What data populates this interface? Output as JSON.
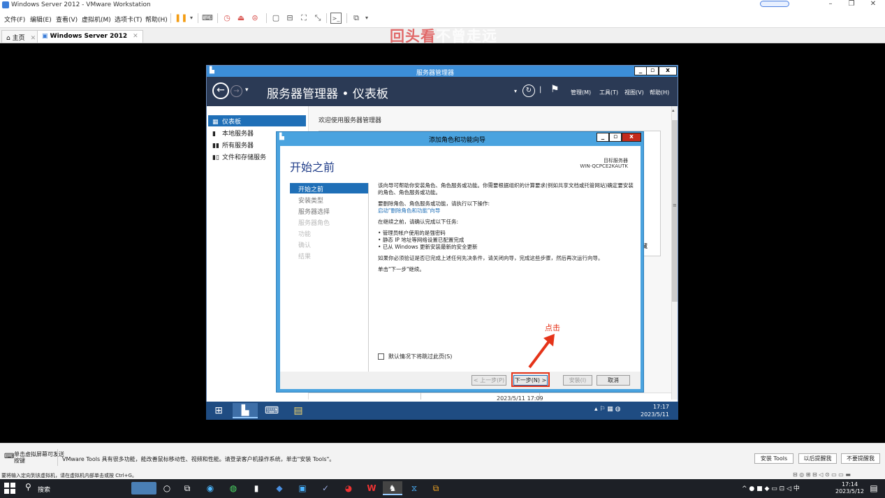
{
  "host": {
    "title": "Windows Server 2012 - VMware Workstation",
    "menus": [
      "文件(F)",
      "编辑(E)",
      "查看(V)",
      "虚拟机(M)",
      "选项卡(T)",
      "帮助(H)"
    ],
    "tabs": [
      {
        "label": "主页"
      },
      {
        "label": "Windows Server 2012"
      }
    ],
    "watermark_red": "回头看",
    "watermark_white": "不曾走远"
  },
  "server_manager": {
    "window_title": "服务器管理器",
    "breadcrumb": "服务器管理器 • 仪表板",
    "menus": [
      "管理(M)",
      "工具(T)",
      "视图(V)",
      "帮助(H)"
    ],
    "sidebar": [
      {
        "label": "仪表板",
        "icon": "grid-icon"
      },
      {
        "label": "本地服务器",
        "icon": "server-icon"
      },
      {
        "label": "所有服务器",
        "icon": "servers-icon"
      },
      {
        "label": "文件和存储服务",
        "icon": "storage-icon"
      }
    ],
    "welcome": "欢迎使用服务器管理器",
    "right_char": "藏",
    "date_footer": "2023/5/11 17:09"
  },
  "wizard": {
    "window_title": "添加角色和功能向导",
    "heading": "开始之前",
    "target_label": "目标服务器",
    "target_server": "WIN-QCPCE2KAUTK",
    "steps": [
      {
        "label": "开始之前",
        "state": "active"
      },
      {
        "label": "安装类型",
        "state": "normal"
      },
      {
        "label": "服务器选择",
        "state": "normal"
      },
      {
        "label": "服务器角色",
        "state": "dim"
      },
      {
        "label": "功能",
        "state": "dim"
      },
      {
        "label": "确认",
        "state": "dim"
      },
      {
        "label": "结果",
        "state": "dim"
      }
    ],
    "para1": "该向导可帮助你安装角色、角色服务或功能。你需要根据组织的计算要求(例如共享文档或托管网站)确定要安装的角色、角色服务或功能。",
    "para2_label": "要删除角色、角色服务或功能，请执行以下操作:",
    "para2_link": "启动\"删除角色和功能\"向导",
    "para3": "在继续之前，请确认完成以下任务:",
    "bullets": [
      "管理员帐户使用的是强密码",
      "静态 IP 地址等网络设置已配置完成",
      "已从 Windows 更新安装最新的安全更新"
    ],
    "para4": "如果你必须验证是否已完成上述任何先决条件，请关闭向导，完成这些步骤，然后再次运行向导。",
    "para5": "单击\"下一步\"继续。",
    "skip_label": "默认情况下将跳过此页(S)",
    "buttons": {
      "prev": "< 上一步(P)",
      "next": "下一步(N) >",
      "install": "安装(I)",
      "cancel": "取消"
    }
  },
  "annotation": {
    "text": "点击",
    "color": "#e53319"
  },
  "guest_taskbar": {
    "time": "17:17",
    "date": "2023/5/11"
  },
  "tools_bar": {
    "hint": "单击虚拟屏幕可发送按键",
    "message": "VMware Tools 具有很多功能，能改善鼠标移动性、视频和性能。请登录客户机操作系统，单击\"安装 Tools\"。",
    "buttons": [
      "安装 Tools",
      "以后提醒我",
      "不要提醒我"
    ]
  },
  "status_bar": {
    "text": "要将输入定向到该虚拟机，请在虚拟机内部单击或按 Ctrl+G。"
  },
  "win_taskbar": {
    "search_placeholder": "搜索",
    "time": "17:14",
    "date": "2023/5/12",
    "ime": "中"
  }
}
